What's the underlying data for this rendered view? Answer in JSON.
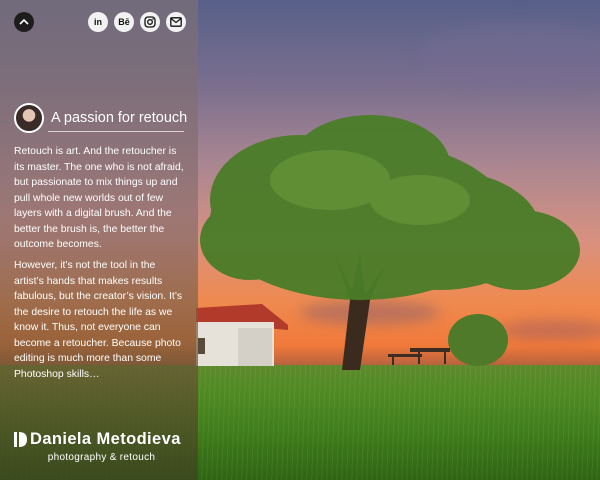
{
  "header": {
    "scroll_up_icon": "chevron-up-icon",
    "social": [
      {
        "name": "linkedin-icon",
        "glyph": "in"
      },
      {
        "name": "behance-icon",
        "glyph": "Bē"
      },
      {
        "name": "instagram-icon",
        "glyph": ""
      },
      {
        "name": "mail-icon",
        "glyph": ""
      }
    ]
  },
  "intro": {
    "title": "A passion for retouch",
    "paragraph_1": "Retouch is art. And the retoucher is its master. The one who is not afraid, but passionate to mix things up and pull whole new worlds out of few layers with a digital brush. And the better the brush is, the better the outcome becomes.",
    "paragraph_2": "However, it’s not the tool in the artist’s hands that makes results fabulous, but the creator’s vision. It’s the desire to retouch the life as we know it. Thus, not everyone can become a retoucher. Because photo editing is much more than some Photoshop skills…"
  },
  "branding": {
    "name": "Daniela Metodieva",
    "tagline": "photography & retouch"
  }
}
